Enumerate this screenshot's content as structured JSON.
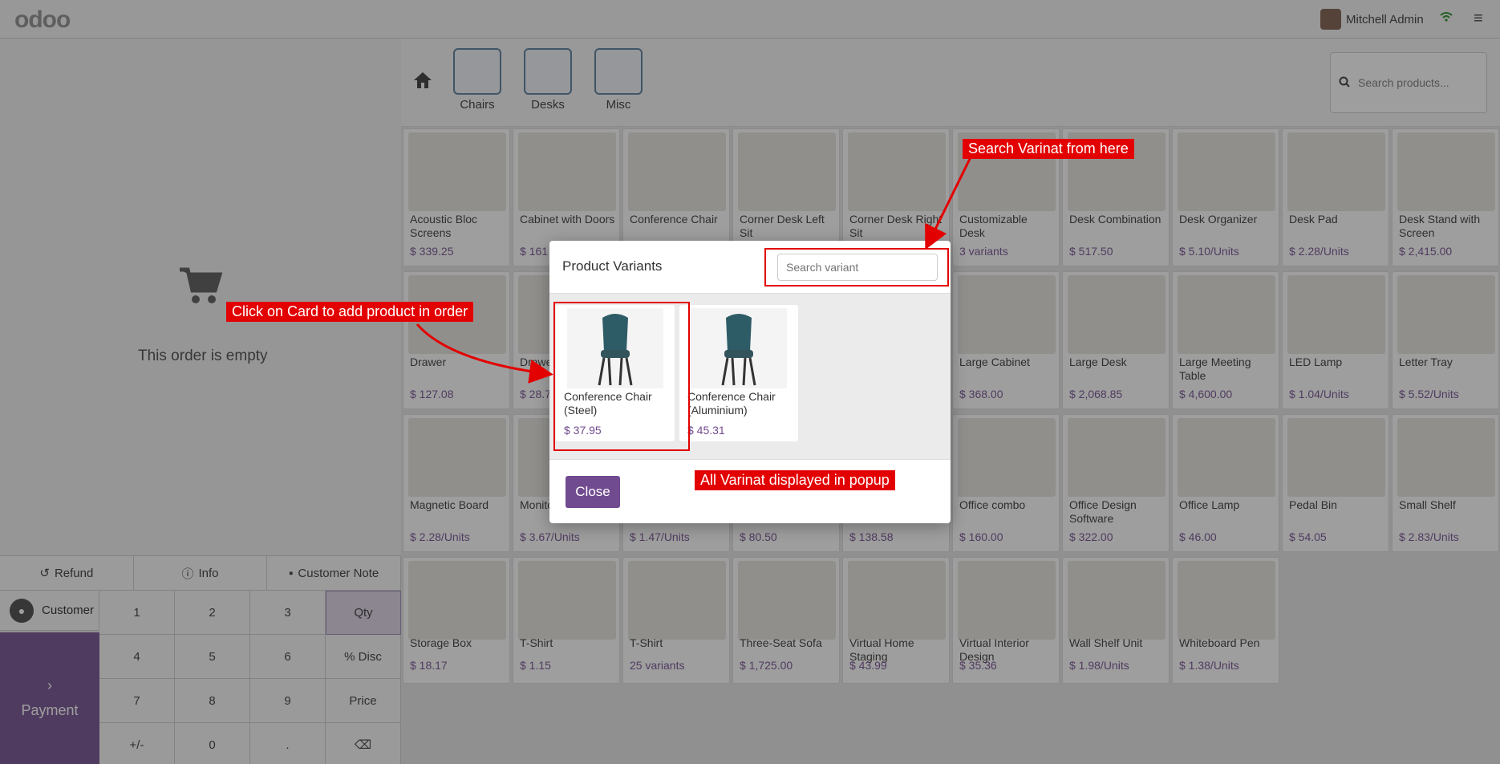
{
  "topbar": {
    "logo": "odoo",
    "user_name": "Mitchell Admin"
  },
  "order": {
    "empty_text": "This order is empty"
  },
  "controls": {
    "refund": "Refund",
    "info": "Info",
    "customer_note": "Customer Note"
  },
  "numpad": {
    "customer_label": "Customer",
    "payment_label": "Payment",
    "keys": [
      "1",
      "2",
      "3",
      "Qty",
      "4",
      "5",
      "6",
      "% Disc",
      "7",
      "8",
      "9",
      "Price",
      "+/-",
      "0",
      ".",
      "⌫"
    ]
  },
  "categories": {
    "items": [
      "Chairs",
      "Desks",
      "Misc"
    ]
  },
  "search": {
    "placeholder": "Search products..."
  },
  "products": [
    {
      "name": "Acoustic Bloc Screens",
      "price": "$ 339.25"
    },
    {
      "name": "Cabinet with Doors",
      "price": "$ 161"
    },
    {
      "name": "Conference Chair",
      "price": ""
    },
    {
      "name": "Corner Desk Left Sit",
      "price": ""
    },
    {
      "name": "Corner Desk Right Sit",
      "price": ""
    },
    {
      "name": "Customizable Desk",
      "price": "3 variants"
    },
    {
      "name": "Desk Combination",
      "price": "$ 517.50"
    },
    {
      "name": "Desk Organizer",
      "price": "$ 5.10/Units"
    },
    {
      "name": "Desk Pad",
      "price": "$ 2.28/Units"
    },
    {
      "name": "Desk Stand with Screen",
      "price": "$ 2,415.00"
    },
    {
      "name": "Drawer",
      "price": "$ 127.08"
    },
    {
      "name": "Drawer",
      "price": "$ 28.7"
    },
    {
      "name": "",
      "price": ""
    },
    {
      "name": "",
      "price": ""
    },
    {
      "name": "",
      "price": ""
    },
    {
      "name": "Large Cabinet",
      "price": "$ 368.00"
    },
    {
      "name": "Large Desk",
      "price": "$ 2,068.85"
    },
    {
      "name": "Large Meeting Table",
      "price": "$ 4,600.00"
    },
    {
      "name": "LED Lamp",
      "price": "$ 1.04/Units"
    },
    {
      "name": "Letter Tray",
      "price": "$ 5.52/Units"
    },
    {
      "name": "Magnetic Board",
      "price": "$ 2.28/Units"
    },
    {
      "name": "Monitor",
      "price": "$ 3.67/Units"
    },
    {
      "name": "",
      "price": "$ 1.47/Units"
    },
    {
      "name": "",
      "price": "$ 80.50"
    },
    {
      "name": "",
      "price": "$ 138.58"
    },
    {
      "name": "Office combo",
      "price": "$ 160.00"
    },
    {
      "name": "Office Design Software",
      "price": "$ 322.00"
    },
    {
      "name": "Office Lamp",
      "price": "$ 46.00"
    },
    {
      "name": "Pedal Bin",
      "price": "$ 54.05"
    },
    {
      "name": "Small Shelf",
      "price": "$ 2.83/Units"
    },
    {
      "name": "Storage Box",
      "price": "$ 18.17"
    },
    {
      "name": "T-Shirt",
      "price": "$ 1.15"
    },
    {
      "name": "T-Shirt",
      "price": "25 variants"
    },
    {
      "name": "Three-Seat Sofa",
      "price": "$ 1,725.00"
    },
    {
      "name": "Virtual Home Staging",
      "price": "$ 43.99"
    },
    {
      "name": "Virtual Interior Design",
      "price": "$ 35.36"
    },
    {
      "name": "Wall Shelf Unit",
      "price": "$ 1.98/Units"
    },
    {
      "name": "Whiteboard Pen",
      "price": "$ 1.38/Units"
    }
  ],
  "modal": {
    "title": "Product Variants",
    "search_placeholder": "Search variant",
    "variants": [
      {
        "name": "Conference Chair (Steel)",
        "price": "$ 37.95"
      },
      {
        "name": "Conference Chair (Aluminium)",
        "price": "$ 45.31"
      }
    ],
    "close_label": "Close"
  },
  "annotations": {
    "search": "Search Varinat from here",
    "click_card": "Click on Card to add product in order",
    "all_variants": "All Varinat displayed in popup"
  },
  "colors": {
    "accent": "#714b8f",
    "annotation": "#e30000"
  }
}
